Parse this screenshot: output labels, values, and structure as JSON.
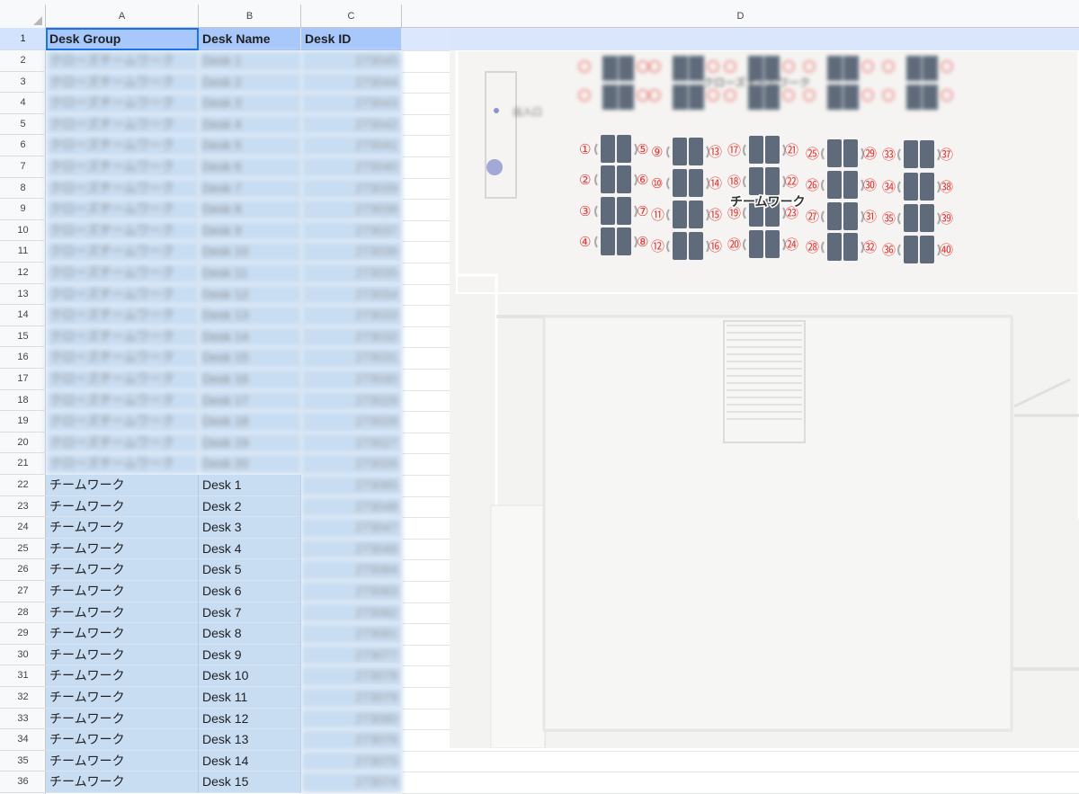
{
  "columns": [
    "A",
    "B",
    "C",
    "D"
  ],
  "header": {
    "desk_group": "Desk Group",
    "desk_name": "Desk Name",
    "desk_id": "Desk ID"
  },
  "rows": [
    {
      "num": "1"
    },
    {
      "num": "2",
      "group": "クローズチームワーク",
      "name": "Desk 1",
      "id": "273045"
    },
    {
      "num": "3",
      "group": "クローズチームワーク",
      "name": "Desk 2",
      "id": "273044"
    },
    {
      "num": "4",
      "group": "クローズチームワーク",
      "name": "Desk 3",
      "id": "273043"
    },
    {
      "num": "5",
      "group": "クローズチームワーク",
      "name": "Desk 4",
      "id": "273042"
    },
    {
      "num": "6",
      "group": "クローズチームワーク",
      "name": "Desk 5",
      "id": "273041"
    },
    {
      "num": "7",
      "group": "クローズチームワーク",
      "name": "Desk 6",
      "id": "273040"
    },
    {
      "num": "8",
      "group": "クローズチームワーク",
      "name": "Desk 7",
      "id": "273039"
    },
    {
      "num": "9",
      "group": "クローズチームワーク",
      "name": "Desk 8",
      "id": "273038"
    },
    {
      "num": "10",
      "group": "クローズチームワーク",
      "name": "Desk 9",
      "id": "273037"
    },
    {
      "num": "11",
      "group": "クローズチームワーク",
      "name": "Desk 10",
      "id": "273036"
    },
    {
      "num": "12",
      "group": "クローズチームワーク",
      "name": "Desk 11",
      "id": "273035"
    },
    {
      "num": "13",
      "group": "クローズチームワーク",
      "name": "Desk 12",
      "id": "273034"
    },
    {
      "num": "14",
      "group": "クローズチームワーク",
      "name": "Desk 13",
      "id": "273033"
    },
    {
      "num": "15",
      "group": "クローズチームワーク",
      "name": "Desk 14",
      "id": "273032"
    },
    {
      "num": "16",
      "group": "クローズチームワーク",
      "name": "Desk 15",
      "id": "273031"
    },
    {
      "num": "17",
      "group": "クローズチームワーク",
      "name": "Desk 16",
      "id": "273030"
    },
    {
      "num": "18",
      "group": "クローズチームワーク",
      "name": "Desk 17",
      "id": "273029"
    },
    {
      "num": "19",
      "group": "クローズチームワーク",
      "name": "Desk 18",
      "id": "273028"
    },
    {
      "num": "20",
      "group": "クローズチームワーク",
      "name": "Desk 19",
      "id": "273027"
    },
    {
      "num": "21",
      "group": "クローズチームワーク",
      "name": "Desk 20",
      "id": "273026"
    },
    {
      "num": "22",
      "group": "チームワーク",
      "name": "Desk 1",
      "id": "273085"
    },
    {
      "num": "23",
      "group": "チームワーク",
      "name": "Desk 2",
      "id": "273048"
    },
    {
      "num": "24",
      "group": "チームワーク",
      "name": "Desk 3",
      "id": "273047"
    },
    {
      "num": "25",
      "group": "チームワーク",
      "name": "Desk 4",
      "id": "273046"
    },
    {
      "num": "26",
      "group": "チームワーク",
      "name": "Desk 5",
      "id": "273084"
    },
    {
      "num": "27",
      "group": "チームワーク",
      "name": "Desk 6",
      "id": "273083"
    },
    {
      "num": "28",
      "group": "チームワーク",
      "name": "Desk 7",
      "id": "273082"
    },
    {
      "num": "29",
      "group": "チームワーク",
      "name": "Desk 8",
      "id": "273081"
    },
    {
      "num": "30",
      "group": "チームワーク",
      "name": "Desk 9",
      "id": "273077"
    },
    {
      "num": "31",
      "group": "チームワーク",
      "name": "Desk 10",
      "id": "273078"
    },
    {
      "num": "32",
      "group": "チームワーク",
      "name": "Desk 11",
      "id": "273079"
    },
    {
      "num": "33",
      "group": "チームワーク",
      "name": "Desk 12",
      "id": "273080"
    },
    {
      "num": "34",
      "group": "チームワーク",
      "name": "Desk 13",
      "id": "273076"
    },
    {
      "num": "35",
      "group": "チームワーク",
      "name": "Desk 14",
      "id": "273075"
    },
    {
      "num": "36",
      "group": "チームワーク",
      "name": "Desk 15",
      "id": "273074"
    }
  ],
  "floor_map": {
    "area_label": "チームワーク",
    "top_area_label": "クローズチームワーク",
    "side_label": "出入口",
    "seat_numbers_left": [
      "①",
      "②",
      "③",
      "④",
      "⑨",
      "⑩",
      "⑪",
      "⑫",
      "⑰",
      "⑱",
      "⑲",
      "⑳",
      "㉕",
      "㉖",
      "㉗",
      "㉘",
      "㉝",
      "㉞",
      "㉟",
      "㊱"
    ],
    "seat_numbers_right": [
      "⑤",
      "⑥",
      "⑦",
      "⑧",
      "⑬",
      "⑭",
      "⑮",
      "⑯",
      "㉑",
      "㉒",
      "㉓",
      "㉔",
      "㉙",
      "㉚",
      "㉛",
      "㉜",
      "㊲",
      "㊳",
      "㊴",
      "㊵"
    ],
    "seat_color": "#e53935",
    "desk_color": "#5f6b7a"
  }
}
